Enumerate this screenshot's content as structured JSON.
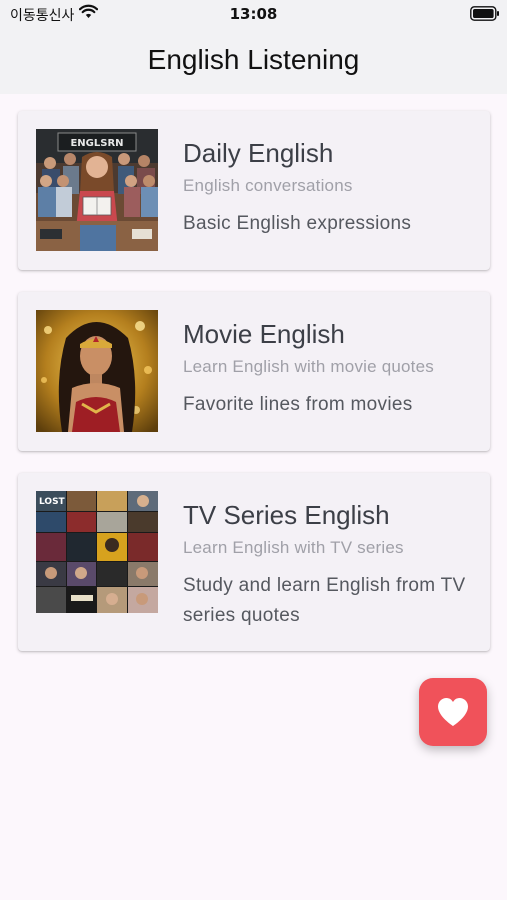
{
  "status_bar": {
    "carrier": "이동통신사",
    "time": "13:08"
  },
  "header": {
    "title": "English Listening"
  },
  "cards": [
    {
      "title": "Daily English",
      "subtitle": "English conversations",
      "description": "Basic English expressions",
      "thumbnail_text": "ENGLSRN"
    },
    {
      "title": "Movie English",
      "subtitle": "Learn English with movie quotes",
      "description": "Favorite lines from movies"
    },
    {
      "title": "TV Series English",
      "subtitle": "Learn English with TV series",
      "description": "Study and learn English from TV series quotes",
      "thumbnail_text": "LOST"
    }
  ],
  "fab": {
    "icon": "heart-icon",
    "color": "#F0525A"
  },
  "colors": {
    "background": "#FCF7FC",
    "header_background": "#F2F2F4",
    "card_background": "#F4F1F6",
    "title_text": "#3C3F47",
    "subtitle_text": "#A0A0A8",
    "description_text": "#55585F"
  }
}
